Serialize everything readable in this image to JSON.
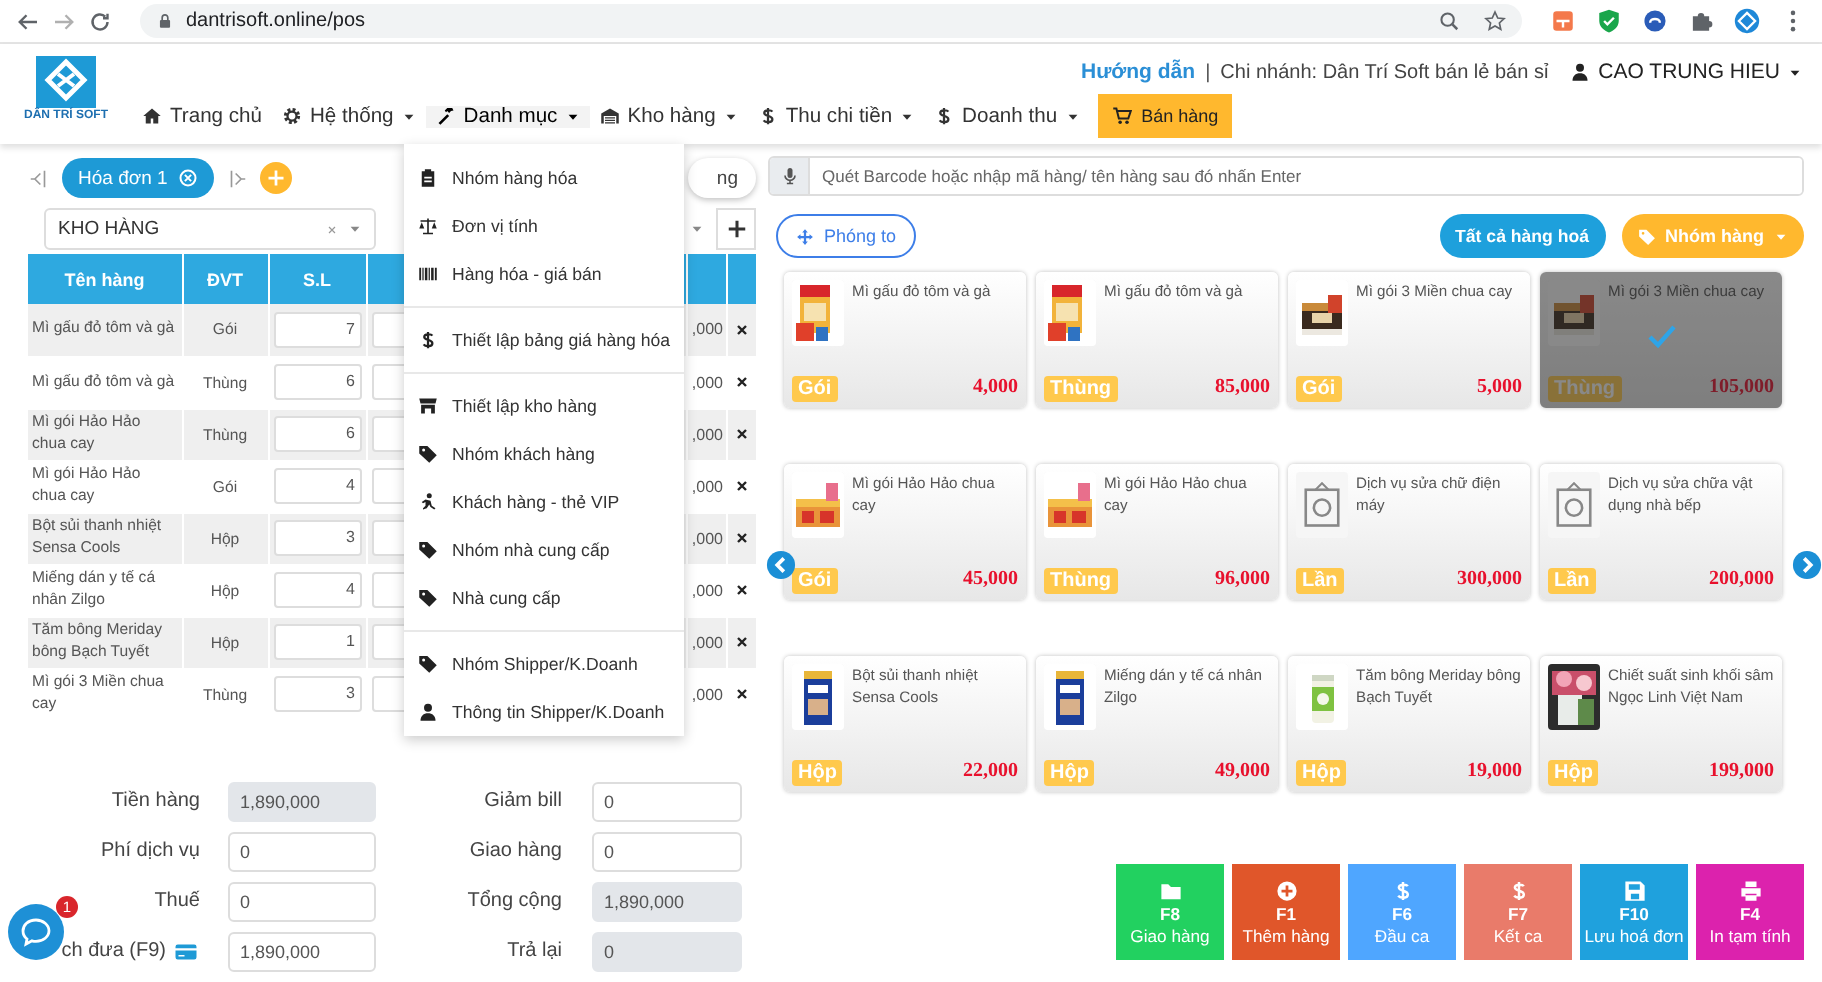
{
  "browser": {
    "url": "dantrisoft.online/pos"
  },
  "header": {
    "logo": "DÂN TRÍ SOFT",
    "help_link": "Hướng dẫn",
    "separator": "|",
    "branch": "Chi nhánh: Dân Trí Soft bán lẻ bán sỉ",
    "user": "CAO TRUNG HIEU"
  },
  "nav": [
    {
      "label": "Trang chủ",
      "kind": "link",
      "has_menu": false,
      "expanded": false
    },
    {
      "label": "Hệ thống",
      "kind": "link",
      "has_menu": true,
      "expanded": false
    },
    {
      "label": "Danh mục",
      "kind": "link",
      "has_menu": true,
      "expanded": true
    },
    {
      "label": "Kho hàng",
      "kind": "link",
      "has_menu": true,
      "expanded": false
    },
    {
      "label": "Thu chi tiền",
      "kind": "link",
      "has_menu": true,
      "expanded": false
    },
    {
      "label": "Doanh thu",
      "kind": "link",
      "has_menu": true,
      "expanded": false
    },
    {
      "label": "Bán hàng",
      "kind": "button",
      "has_menu": false,
      "expanded": false
    }
  ],
  "category_menu": {
    "groups": [
      [
        {
          "label": "Nhóm hàng hóa"
        },
        {
          "label": "Đơn vị tính"
        },
        {
          "label": "Hàng hóa - giá bán"
        }
      ],
      [
        {
          "label": "Thiết lập bảng giá hàng hóa"
        }
      ],
      [
        {
          "label": "Thiết lập kho hàng"
        },
        {
          "label": "Nhóm khách hàng"
        },
        {
          "label": "Khách hàng - thẻ VIP"
        },
        {
          "label": "Nhóm nhà cung cấp"
        },
        {
          "label": "Nhà cung cấp"
        }
      ],
      [
        {
          "label": "Nhóm Shipper/K.Doanh"
        },
        {
          "label": "Thông tin Shipper/K.Doanh"
        }
      ]
    ]
  },
  "invoice_tabs": [
    {
      "label": "Hóa đơn 1",
      "selected": true
    }
  ],
  "partial_pill": "ng",
  "warehouse_select": {
    "value": "KHO HÀNG"
  },
  "cart_table": {
    "columns": [
      "Tên hàng",
      "ĐVT",
      "S.L"
    ],
    "rows": [
      {
        "name": "Mì gấu đỏ tôm và gà",
        "unit": "Gói",
        "qty": "7",
        "column_5": ",000"
      },
      {
        "name": "Mì gấu đỏ tôm và gà",
        "unit": "Thùng",
        "qty": "6",
        "column_5": ",000"
      },
      {
        "name": "Mì gói Hảo Hảo chua cay",
        "unit": "Thùng",
        "qty": "6",
        "column_5": ",000"
      },
      {
        "name": "Mì gói Hảo Hảo chua cay",
        "unit": "Gói",
        "qty": "4",
        "column_5": ",000"
      },
      {
        "name": "Bột sủi thanh nhiệt Sensa Cools",
        "unit": "Hộp",
        "qty": "3",
        "column_5": ",000"
      },
      {
        "name": "Miếng dán y tế cá nhân Zilgo",
        "unit": "Hộp",
        "qty": "4",
        "column_5": ",000"
      },
      {
        "name": "Tăm bông Meriday bông Bạch Tuyết",
        "unit": "Hộp",
        "qty": "1",
        "column_5": ",000"
      },
      {
        "name": "Mì gói 3 Miền chua cay",
        "unit": "Thùng",
        "qty": "3",
        "column_5": ",000"
      }
    ]
  },
  "search": {
    "placeholder": "Quét Barcode hoặc nhập mã hàng/ tên hàng sau đó nhấn Enter"
  },
  "zoom_button": "Phóng to",
  "all_button": "Tất cả hàng hoá",
  "group_button": "Nhóm hàng",
  "products": [
    {
      "name": "Mì gấu đỏ tôm và gà",
      "unit": "Gói",
      "price": "4,000",
      "kind": "product",
      "selected": false
    },
    {
      "name": "Mì gấu đỏ tôm và gà",
      "unit": "Thùng",
      "price": "85,000",
      "kind": "product",
      "selected": false
    },
    {
      "name": "Mì gói 3 Miền chua cay",
      "unit": "Gói",
      "price": "5,000",
      "kind": "product",
      "selected": false
    },
    {
      "name": "Mì gói 3 Miền chua cay",
      "unit": "Thùng",
      "price": "105,000",
      "kind": "product",
      "selected": true
    },
    {
      "name": "Mì gói Hảo Hảo chua cay",
      "unit": "Gói",
      "price": "45,000",
      "kind": "product",
      "selected": false
    },
    {
      "name": "Mì gói Hảo Hảo chua cay",
      "unit": "Thùng",
      "price": "96,000",
      "kind": "product",
      "selected": false
    },
    {
      "name": "Dịch vụ sửa chữ điện máy",
      "unit": "Lần",
      "price": "300,000",
      "kind": "service",
      "selected": false
    },
    {
      "name": "Dịch vụ sửa chữa vật dụng nhà bếp",
      "unit": "Lần",
      "price": "200,000",
      "kind": "service",
      "selected": false
    },
    {
      "name": "Bột sủi thanh nhiệt Sensa Cools",
      "unit": "Hộp",
      "price": "22,000",
      "kind": "product",
      "selected": false
    },
    {
      "name": "Miếng dán y tế cá nhân Zilgo",
      "unit": "Hộp",
      "price": "49,000",
      "kind": "product",
      "selected": false
    },
    {
      "name": "Tăm bông Meriday bông Bạch Tuyết",
      "unit": "Hộp",
      "price": "19,000",
      "kind": "product",
      "selected": false
    },
    {
      "name": "Chiết suất sinh khối sâm Ngọc Linh Việt Nam",
      "unit": "Hộp",
      "price": "199,000",
      "kind": "product",
      "selected": false
    }
  ],
  "summary": {
    "left": [
      {
        "label": "Tiền hàng",
        "value": "1,890,000",
        "readonly": true,
        "kind": "field"
      },
      {
        "label": "Phí dịch vụ",
        "value": "0",
        "readonly": false,
        "kind": "field"
      },
      {
        "label": "Thuế",
        "value": "0",
        "readonly": false,
        "kind": "field"
      },
      {
        "label": "ch đưa (F9)",
        "value": "1,890,000",
        "readonly": false,
        "kind": "payment"
      }
    ],
    "right": [
      {
        "label": "Giảm bill",
        "value": "0",
        "readonly": false,
        "kind": "field"
      },
      {
        "label": "Giao hàng",
        "value": "0",
        "readonly": false,
        "kind": "field"
      },
      {
        "label": "Tổng cộng",
        "value": "1,890,000",
        "readonly": true,
        "kind": "field"
      },
      {
        "label": "Trả lại",
        "value": "0",
        "readonly": true,
        "kind": "field"
      }
    ]
  },
  "actions": [
    {
      "key": "F8",
      "label": "Giao hàng",
      "color": "#22d160"
    },
    {
      "key": "F1",
      "label": "Thêm hàng",
      "color": "#e0562a"
    },
    {
      "key": "F6",
      "label": "Đầu ca",
      "color": "#4fa6ff"
    },
    {
      "key": "F7",
      "label": "Kết ca",
      "color": "#e97b6a"
    },
    {
      "key": "F10",
      "label": "Lưu hoá đơn",
      "color": "#1fa1dd"
    },
    {
      "key": "F4",
      "label": "In tạm tính",
      "color": "#dc22ad"
    }
  ],
  "chat": {
    "badge": "1"
  }
}
